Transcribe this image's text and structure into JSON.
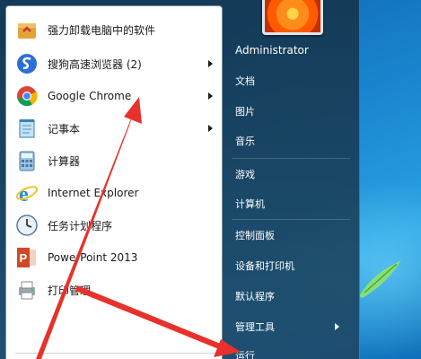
{
  "programs": [
    {
      "label": "强力卸载电脑中的软件",
      "icon": "uninstall-box-icon",
      "has_submenu": false
    },
    {
      "label": "搜狗高速浏览器 (2)",
      "icon": "sogou-browser-icon",
      "has_submenu": true
    },
    {
      "label": "Google Chrome",
      "icon": "chrome-icon",
      "has_submenu": true
    },
    {
      "label": "记事本",
      "icon": "notepad-icon",
      "has_submenu": true
    },
    {
      "label": "计算器",
      "icon": "calculator-icon",
      "has_submenu": false
    },
    {
      "label": "Internet Explorer",
      "icon": "internet-explorer-icon",
      "has_submenu": false
    },
    {
      "label": "任务计划程序",
      "icon": "task-scheduler-icon",
      "has_submenu": false
    },
    {
      "label": "PowerPoint 2013",
      "icon": "powerpoint-icon",
      "has_submenu": false
    },
    {
      "label": "打印管理",
      "icon": "print-management-icon",
      "has_submenu": false
    }
  ],
  "right_pane": {
    "user_name": "Administrator",
    "items": [
      {
        "label": "文档",
        "has_submenu": false
      },
      {
        "label": "图片",
        "has_submenu": false
      },
      {
        "label": "音乐",
        "has_submenu": false
      },
      {
        "label": "游戏",
        "has_submenu": false
      },
      {
        "label": "计算机",
        "has_submenu": false
      },
      {
        "label": "控制面板",
        "has_submenu": false
      },
      {
        "label": "设备和打印机",
        "has_submenu": false
      },
      {
        "label": "默认程序",
        "has_submenu": false
      },
      {
        "label": "管理工具",
        "has_submenu": true
      },
      {
        "label": "运行",
        "has_submenu": false
      }
    ]
  },
  "colors": {
    "annotation_red": "#e8312a",
    "menu_dark": "#1e4664",
    "left_pane_bg": "#ffffff"
  }
}
